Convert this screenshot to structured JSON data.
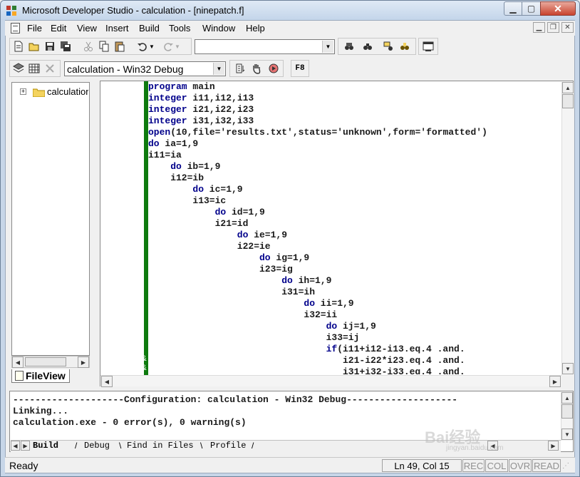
{
  "window": {
    "title": "Microsoft Developer Studio - calculation - [ninepatch.f]"
  },
  "menu": [
    {
      "label": "File"
    },
    {
      "label": "Edit"
    },
    {
      "label": "View"
    },
    {
      "label": "Insert"
    },
    {
      "label": "Build"
    },
    {
      "label": "Tools"
    },
    {
      "label": "Window"
    },
    {
      "label": "Help"
    }
  ],
  "toolbar": {
    "find_combo_value": "",
    "config_combo_value": "calculation - Win32 Debug",
    "f8_label": "F8"
  },
  "workspace": {
    "tree_root_label": "calculation",
    "tab_label": "FileView"
  },
  "editor": {
    "lines": [
      {
        "kw": "program",
        "rest": " main",
        "indent": 0
      },
      {
        "kw": "integer",
        "rest": " i11,i12,i13",
        "indent": 0
      },
      {
        "kw": "integer",
        "rest": " i21,i22,i23",
        "indent": 0
      },
      {
        "kw": "integer",
        "rest": " i31,i32,i33",
        "indent": 0
      },
      {
        "kw": "open",
        "rest": "(10,file='results.txt',status='unknown',form='formatted')",
        "indent": 0
      },
      {
        "kw": "do",
        "rest": " ia=1,9",
        "indent": 0
      },
      {
        "kw": "",
        "rest": "i11=ia",
        "indent": 0
      },
      {
        "kw": "do",
        "rest": " ib=1,9",
        "indent": 4
      },
      {
        "kw": "",
        "rest": "i12=ib",
        "indent": 4
      },
      {
        "kw": "do",
        "rest": " ic=1,9",
        "indent": 8
      },
      {
        "kw": "",
        "rest": "i13=ic",
        "indent": 8
      },
      {
        "kw": "do",
        "rest": " id=1,9",
        "indent": 12
      },
      {
        "kw": "",
        "rest": "i21=id",
        "indent": 12
      },
      {
        "kw": "do",
        "rest": " ie=1,9",
        "indent": 16
      },
      {
        "kw": "",
        "rest": "i22=ie",
        "indent": 16
      },
      {
        "kw": "do",
        "rest": " ig=1,9",
        "indent": 20
      },
      {
        "kw": "",
        "rest": "i23=ig",
        "indent": 20
      },
      {
        "kw": "do",
        "rest": " ih=1,9",
        "indent": 24
      },
      {
        "kw": "",
        "rest": "i31=ih",
        "indent": 24
      },
      {
        "kw": "do",
        "rest": " ii=1,9",
        "indent": 28
      },
      {
        "kw": "",
        "rest": "i32=ii",
        "indent": 28
      },
      {
        "kw": "do",
        "rest": " ij=1,9",
        "indent": 32
      },
      {
        "kw": "",
        "rest": "i33=ij",
        "indent": 32
      },
      {
        "kw": "if",
        "rest": "(i11+i12-i13.eq.4 .and.",
        "indent": 32
      },
      {
        "kw": "",
        "rest": "i21-i22*i23.eq.4 .and.",
        "indent": 35
      },
      {
        "kw": "",
        "rest": "i31+i32-i33.eq.4 .and.",
        "indent": 35
      }
    ],
    "continuation_marks": [
      "&",
      "&"
    ]
  },
  "output": {
    "lines": [
      "--------------------Configuration: calculation - Win32 Debug--------------------",
      "Linking...",
      "calculation.exe - 0 error(s), 0 warning(s)"
    ],
    "tabs": [
      {
        "label": "Build",
        "active": true
      },
      {
        "label": "Debug",
        "active": false
      },
      {
        "label": "Find in Files",
        "active": false
      },
      {
        "label": "Profile",
        "active": false
      }
    ]
  },
  "status": {
    "text": "Ready",
    "position": "Ln 49, Col 15",
    "indicators": [
      "REC",
      "COL",
      "OVR",
      "READ"
    ]
  },
  "colors": {
    "keyword": "#00008b",
    "gutter_bar": "#0e7a0e",
    "close_button": "#c8432f"
  },
  "watermark": {
    "text": "Bai经验",
    "subtext": "jingyan.baidu.com"
  }
}
